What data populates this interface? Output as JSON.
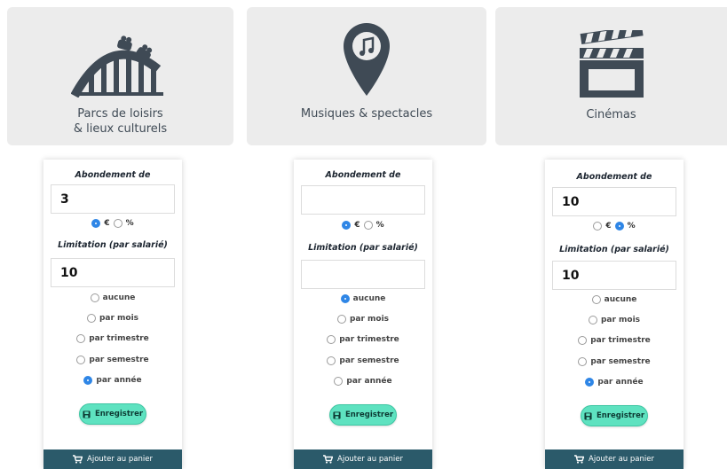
{
  "categories": [
    {
      "id": "parcs",
      "line1": "Parcs de loisirs",
      "line2": "& lieux culturels"
    },
    {
      "id": "musiques",
      "line1": "Musiques & spectacles",
      "line2": ""
    },
    {
      "id": "cinemas",
      "line1": "Cinémas",
      "line2": ""
    }
  ],
  "labels": {
    "abondement": "Abondement de",
    "limitation": "Limitation (par salarié)",
    "euro": "€",
    "percent": "%",
    "save": "Enregistrer",
    "cart": "Ajouter au panier"
  },
  "periods": [
    "aucune",
    "par mois",
    "par trimestre",
    "par semestre",
    "par année"
  ],
  "panels": [
    {
      "abondement": "3",
      "unit": "euro",
      "limitation": "10",
      "period": "par année"
    },
    {
      "abondement": "",
      "unit": "euro",
      "limitation": "",
      "period": "aucune"
    },
    {
      "abondement": "10",
      "unit": "percent",
      "limitation": "10",
      "period": "par année"
    }
  ],
  "colors": {
    "accent": "#2f86e6",
    "save": "#5ee2c0",
    "cart": "#2b5a6a",
    "icon": "#3f4a55"
  }
}
